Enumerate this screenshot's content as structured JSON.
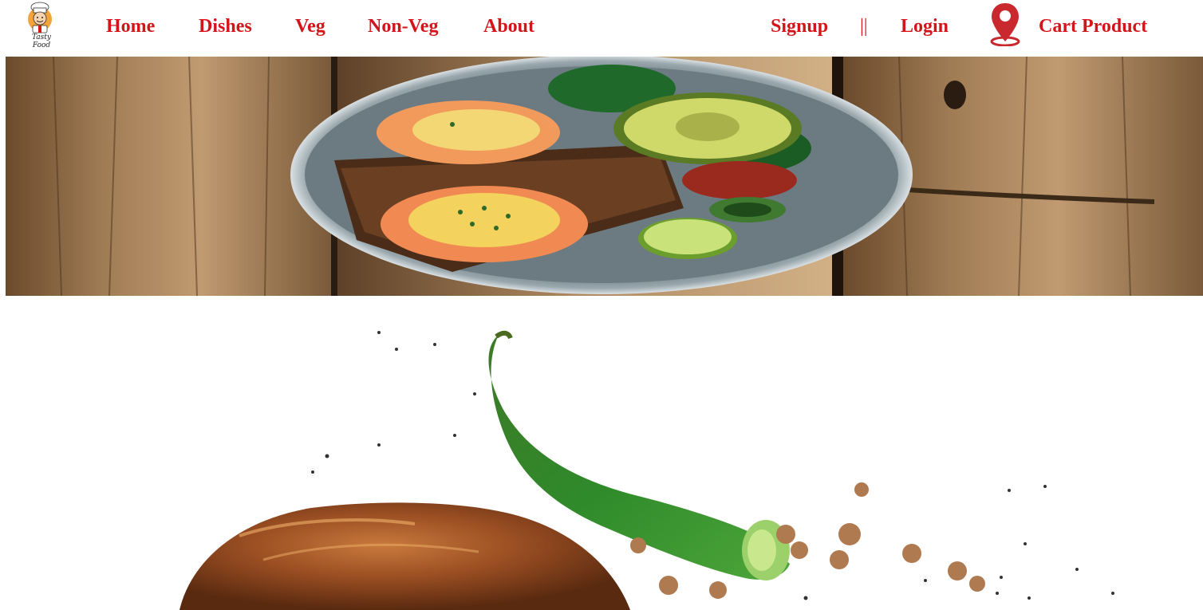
{
  "brand": {
    "logo_text": "Tasty Food"
  },
  "nav": {
    "home": "Home",
    "dishes": "Dishes",
    "veg": "Veg",
    "nonveg": "Non-Veg",
    "about": "About",
    "signup": "Signup",
    "separator": "||",
    "login": "Login",
    "cart": "Cart Product"
  },
  "icons": {
    "logo": "chef-logo-icon",
    "location": "location-pin-icon"
  },
  "colors": {
    "nav_text": "#d3151b",
    "pin": "#c8282e",
    "background": "#ffffff"
  },
  "images": {
    "banner": "breakfast-plate-on-wooden-table",
    "food": "grilled-chicken-with-green-chili-and-peppercorns"
  }
}
